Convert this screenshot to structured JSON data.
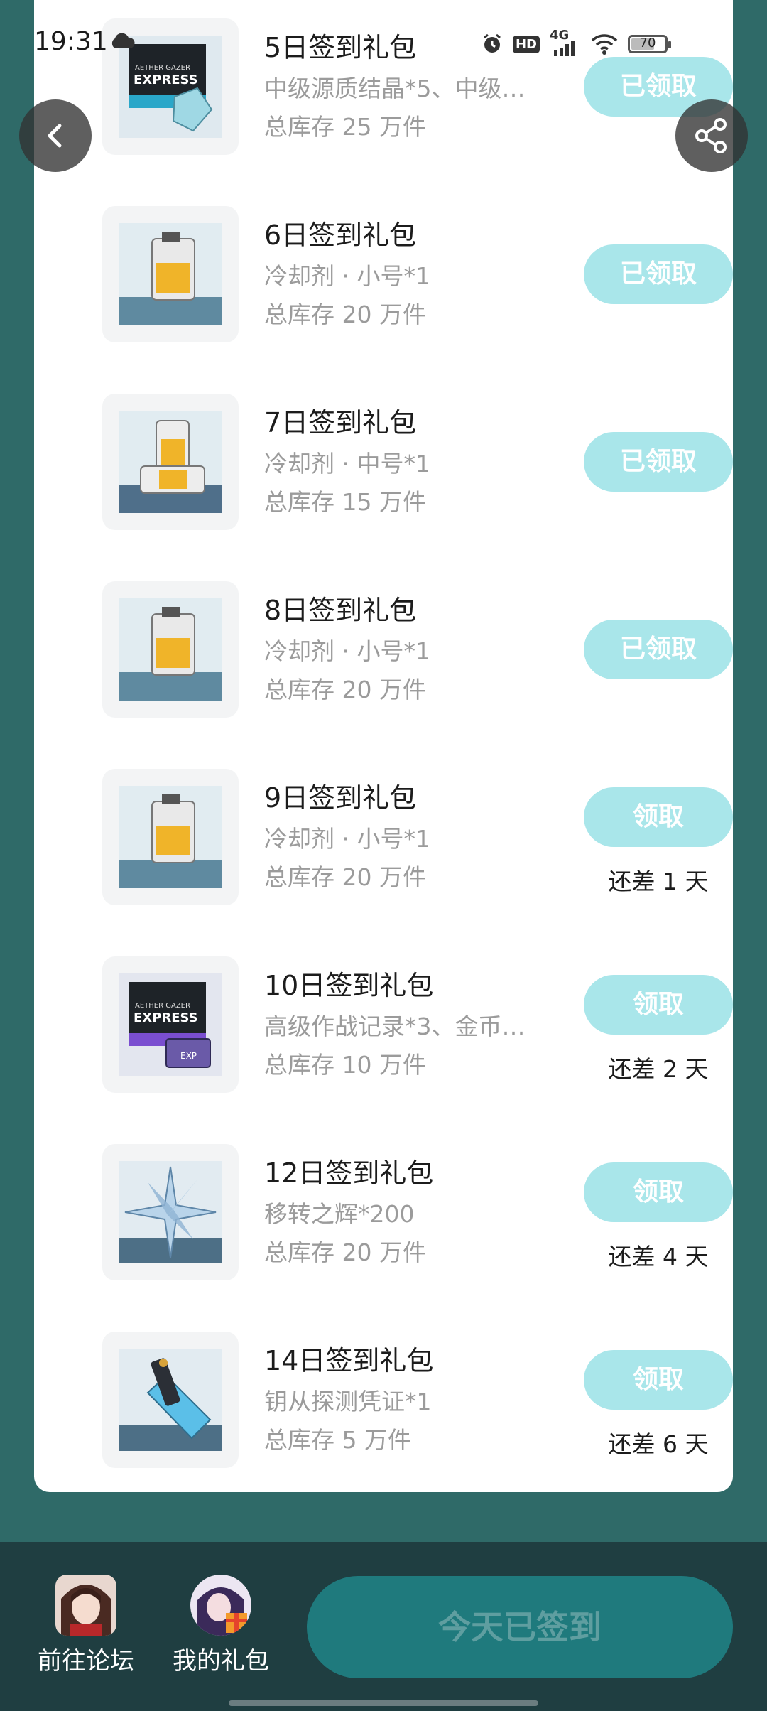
{
  "status_bar": {
    "time": "19:31",
    "hd": "HD",
    "network": "4G",
    "battery": "70",
    "battery_level": 0.7
  },
  "nav": {
    "back_icon": "chevron-left-icon",
    "share_icon": "share-icon"
  },
  "rewards": [
    {
      "title": "5日签到礼包",
      "desc": "中级源质结晶*5、中级…",
      "stock": "总库存 25 万件",
      "button": "已领取",
      "remaining": "",
      "image": "express-box-crystal"
    },
    {
      "title": "6日签到礼包",
      "desc": "冷却剂 · 小号*1",
      "stock": "总库存 20 万件",
      "button": "已领取",
      "remaining": "",
      "image": "coolant-small"
    },
    {
      "title": "7日签到礼包",
      "desc": "冷却剂 · 中号*1",
      "stock": "总库存 15 万件",
      "button": "已领取",
      "remaining": "",
      "image": "coolant-medium"
    },
    {
      "title": "8日签到礼包",
      "desc": "冷却剂 · 小号*1",
      "stock": "总库存 20 万件",
      "button": "已领取",
      "remaining": "",
      "image": "coolant-small"
    },
    {
      "title": "9日签到礼包",
      "desc": "冷却剂 · 小号*1",
      "stock": "总库存 20 万件",
      "button": "领取",
      "remaining": "还差 1 天",
      "image": "coolant-small"
    },
    {
      "title": "10日签到礼包",
      "desc": "高级作战记录*3、金币…",
      "stock": "总库存 10 万件",
      "button": "领取",
      "remaining": "还差 2 天",
      "image": "express-box-exp"
    },
    {
      "title": "12日签到礼包",
      "desc": "移转之辉*200",
      "stock": "总库存 20 万件",
      "button": "领取",
      "remaining": "还差 4 天",
      "image": "crystal-star"
    },
    {
      "title": "14日签到礼包",
      "desc": "钥从探测凭证*1",
      "stock": "总库存 5 万件",
      "button": "领取",
      "remaining": "还差 6 天",
      "image": "probe-key"
    }
  ],
  "bottom_bar": {
    "forum_label": "前往论坛",
    "gifts_label": "我的礼包",
    "signed_label": "今天已签到"
  },
  "colors": {
    "background": "#2f6a68",
    "button_light": "#a9e6ea",
    "bottom_bar": "#1f3e41",
    "signed_button": "#1f7a7d"
  }
}
